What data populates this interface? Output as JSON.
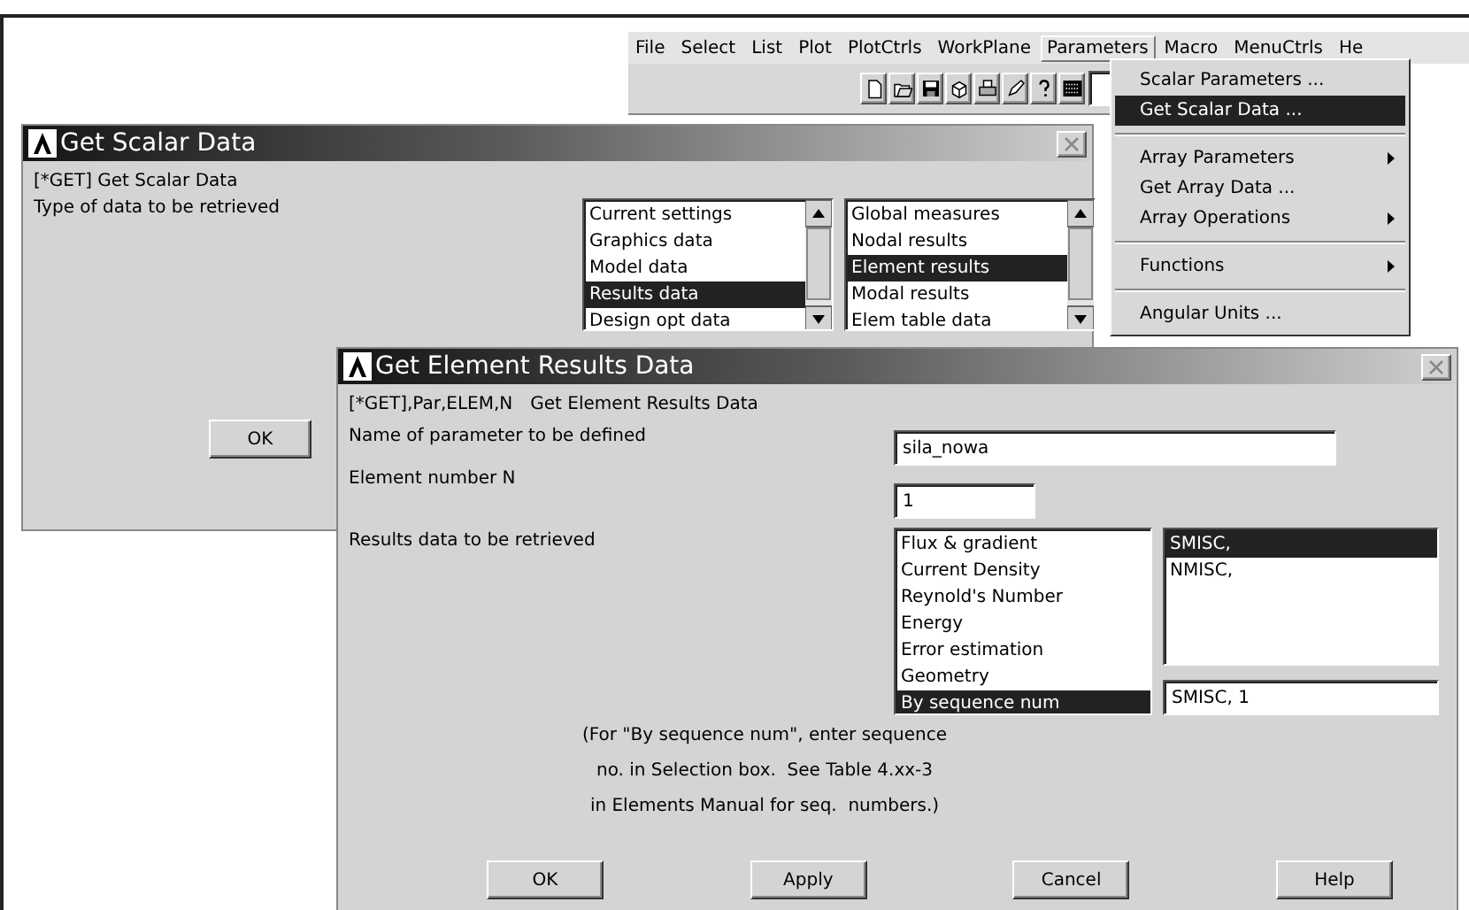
{
  "menubar": {
    "items": [
      {
        "label": "File",
        "selected": false
      },
      {
        "label": "Select",
        "selected": false
      },
      {
        "label": "List",
        "selected": false
      },
      {
        "label": "Plot",
        "selected": false
      },
      {
        "label": "PlotCtrls",
        "selected": false
      },
      {
        "label": "WorkPlane",
        "selected": false
      },
      {
        "label": "Parameters",
        "selected": true
      },
      {
        "label": "Macro",
        "selected": false
      },
      {
        "label": "MenuCtrls",
        "selected": false
      },
      {
        "label": "He",
        "selected": false
      }
    ]
  },
  "scalar_dialog": {
    "title": "Get Scalar Data",
    "command": "[*GET]  Get Scalar Data",
    "prompt": "Type of data to be retrieved",
    "lists": [
      {
        "items": [
          {
            "label": "Current settings",
            "selected": false
          },
          {
            "label": "Graphics data",
            "selected": false
          },
          {
            "label": "Model data",
            "selected": false
          },
          {
            "label": "Results data",
            "selected": true
          },
          {
            "label": "Design opt data",
            "selected": false
          }
        ]
      },
      {
        "items": [
          {
            "label": "Global measures",
            "selected": false
          },
          {
            "label": "Nodal results",
            "selected": false
          },
          {
            "label": "Element results",
            "selected": true
          },
          {
            "label": "Modal results",
            "selected": false
          },
          {
            "label": "Elem table data",
            "selected": false
          }
        ]
      }
    ],
    "ok_button": "OK"
  },
  "parameters_menu": {
    "items": [
      {
        "kind": "item",
        "label": "Scalar Parameters  ...",
        "selected": false
      },
      {
        "kind": "item",
        "label": "Get Scalar Data  ...",
        "selected": true
      },
      {
        "kind": "separator"
      },
      {
        "kind": "submenu",
        "label": "Array Parameters",
        "selected": false
      },
      {
        "kind": "item",
        "label": "Get Array Data  ...",
        "selected": false
      },
      {
        "kind": "submenu",
        "label": "Array Operations",
        "selected": false
      },
      {
        "kind": "separator"
      },
      {
        "kind": "submenu",
        "label": "Functions",
        "selected": false
      },
      {
        "kind": "separator"
      },
      {
        "kind": "item",
        "label": "Angular Units   ...",
        "selected": false
      }
    ]
  },
  "element_dialog": {
    "title": "Get Element Results Data",
    "command": "[*GET],Par,ELEM,N",
    "command_title": "Get Element Results Data",
    "fields": [
      {
        "label": "Name of parameter to be defined",
        "value": "sila_nowa"
      },
      {
        "label": "Element number N",
        "value": "1"
      }
    ],
    "results_label": "Results data to be retrieved",
    "item_list": [
      {
        "label": "Flux & gradient",
        "selected": false
      },
      {
        "label": "Current Density",
        "selected": false
      },
      {
        "label": "Reynold's Number",
        "selected": false
      },
      {
        "label": "Energy",
        "selected": false
      },
      {
        "label": "Error estimation",
        "selected": false
      },
      {
        "label": "Geometry",
        "selected": false
      },
      {
        "label": "By sequence num",
        "selected": true
      }
    ],
    "component_list": [
      {
        "label": "SMISC,",
        "selected": true
      },
      {
        "label": "NMISC,",
        "selected": false
      }
    ],
    "selection_value": "SMISC, 1",
    "note": [
      "(For \"By sequence num\", enter sequence",
      "no. in Selection box.  See Table 4.xx-3",
      "in Elements Manual for seq.  numbers.)"
    ],
    "buttons": [
      "OK",
      "Apply",
      "Cancel",
      "Help"
    ]
  }
}
